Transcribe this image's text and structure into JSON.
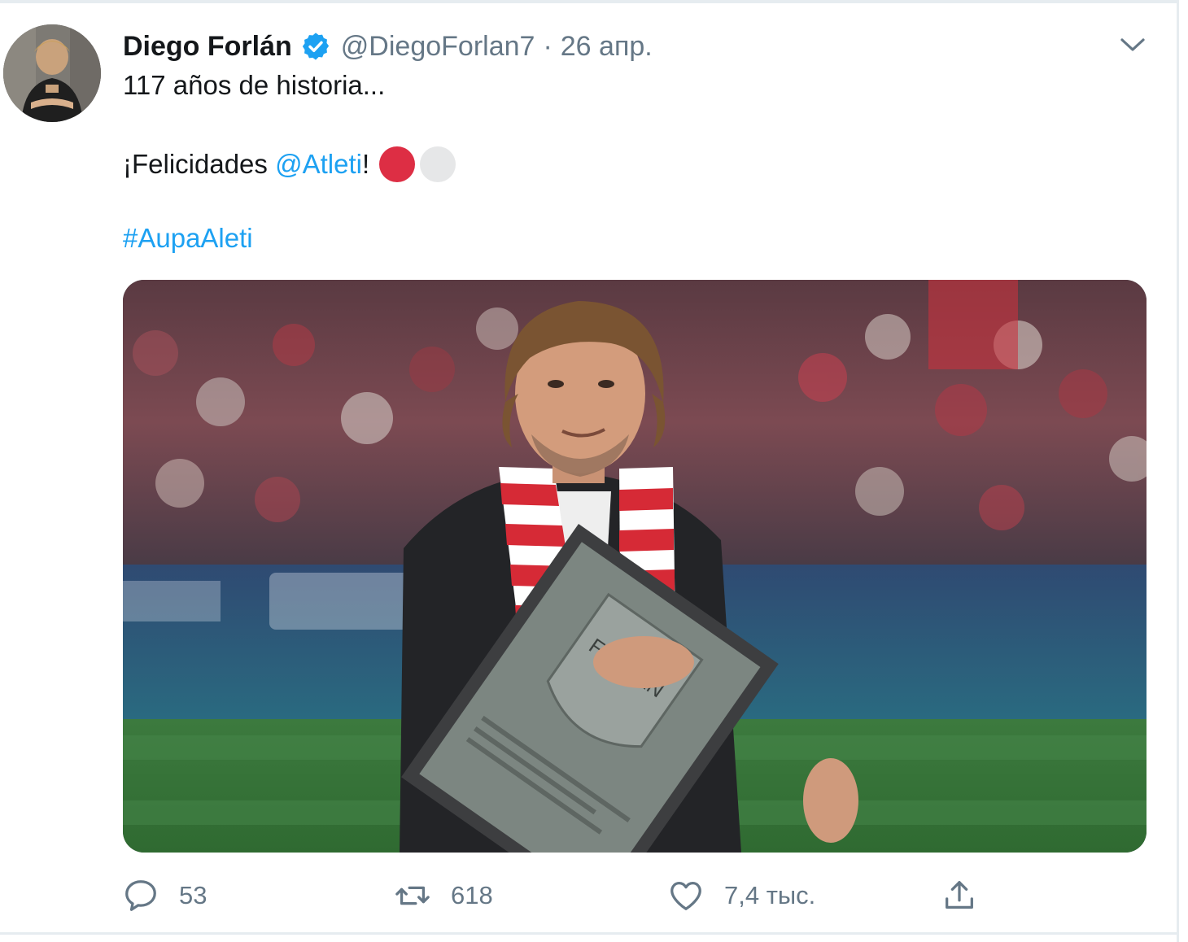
{
  "tweet": {
    "author_name": "Diego Forlán",
    "handle": "@DiegoForlan7",
    "separator": "·",
    "date": "26 апр.",
    "text_line1": "117 años de historia...",
    "text_line2_prefix": "¡Felicidades ",
    "text_line2_mention": "@Atleti",
    "text_line2_suffix": "!",
    "hashtag": "#AupaAleti",
    "plaque_lines": [
      "FORLÁN"
    ]
  },
  "actions": {
    "replies": "53",
    "retweets": "618",
    "likes": "7,4 тыс."
  },
  "icons": {
    "verified": "verified-badge-icon",
    "caret": "chevron-down-icon",
    "reply": "reply-icon",
    "retweet": "retweet-icon",
    "like": "heart-icon",
    "share": "share-icon"
  },
  "colors": {
    "link": "#1da1f2",
    "secondary_text": "#657786",
    "emoji_red": "#dd2e44",
    "emoji_white": "#e6e7e8"
  }
}
